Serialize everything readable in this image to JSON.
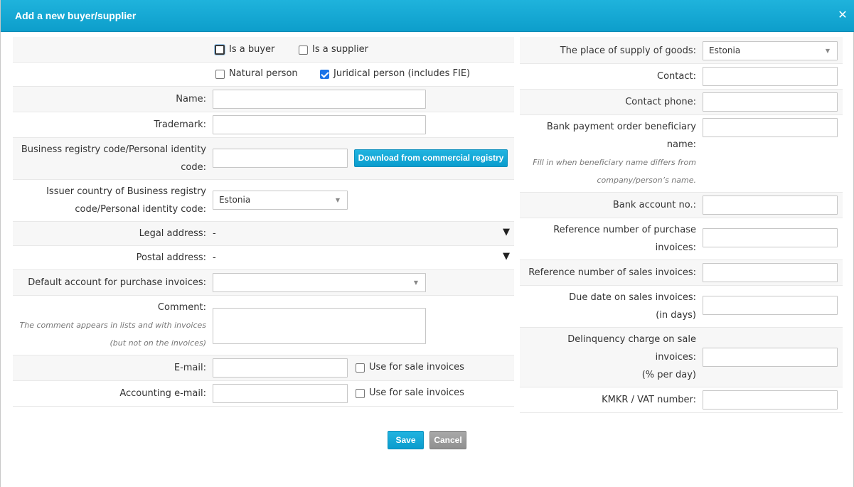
{
  "dialog": {
    "title": "Add a new buyer/supplier",
    "close_label": "✕"
  },
  "left": {
    "is_buyer": {
      "label": "Is a buyer",
      "checked": false
    },
    "is_supplier": {
      "label": "Is a supplier",
      "checked": false
    },
    "natural_person": {
      "label": "Natural person",
      "checked": false
    },
    "juridical_person": {
      "label": "Juridical person (includes FIE)",
      "checked": true
    },
    "name_label": "Name:",
    "name_value": "",
    "trademark_label": "Trademark:",
    "trademark_value": "",
    "regcode_label_1": "Business registry code/Personal identity",
    "regcode_label_2": "code:",
    "regcode_value": "",
    "download_button": "Download from commercial registry",
    "issuer_label_1": "Issuer country of Business registry",
    "issuer_label_2": "code/Personal identity code:",
    "issuer_value": "Estonia",
    "legal_label": "Legal address:",
    "legal_value": "-",
    "postal_label": "Postal address:",
    "postal_value": "-",
    "default_account_label": "Default account for purchase invoices:",
    "default_account_value": "",
    "comment_label": "Comment:",
    "comment_hint_1": "The comment appears in lists and with invoices",
    "comment_hint_2": "(but not on the invoices)",
    "email_label": "E-mail:",
    "email_value": "",
    "email_use": "Use for sale invoices",
    "acc_email_label": "Accounting e-mail:",
    "acc_email_value": "",
    "acc_email_use": "Use for sale invoices"
  },
  "right": {
    "supply_label": "The place of supply of goods:",
    "supply_value": "Estonia",
    "contact_label": "Contact:",
    "contact_value": "",
    "phone_label": "Contact phone:",
    "phone_value": "",
    "beneficiary_label_1": "Bank payment order beneficiary",
    "beneficiary_label_2": "name:",
    "beneficiary_hint_1": "Fill in when beneficiary name differs from",
    "beneficiary_hint_2": "company/person’s name.",
    "beneficiary_value": "",
    "bank_label": "Bank account no.:",
    "bank_value": "",
    "ref_purchase_label_1": "Reference number of purchase",
    "ref_purchase_label_2": "invoices:",
    "ref_purchase_value": "",
    "ref_sales_label": "Reference number of sales invoices:",
    "ref_sales_value": "",
    "due_label_1": "Due date on sales invoices:",
    "due_label_2": "(in days)",
    "due_value": "",
    "delinq_label_1": "Delinquency charge on sale",
    "delinq_label_2": "invoices:",
    "delinq_label_3": "(% per day)",
    "delinq_value": "",
    "vat_label": "KMKR / VAT number:",
    "vat_value": ""
  },
  "footer": {
    "save": "Save",
    "cancel": "Cancel"
  },
  "colors": {
    "accent": "#0d9ecb",
    "checkbox_checked": "#1a73e8",
    "cancel": "#8f8f8f"
  }
}
